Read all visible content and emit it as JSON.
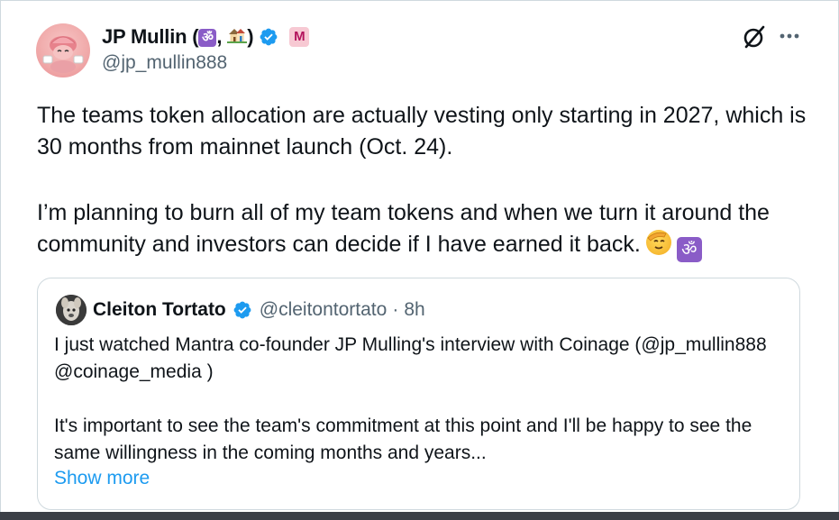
{
  "author": {
    "display_name": "JP Mullin (",
    "name_separator": ", ",
    "name_close": ")",
    "om_glyph": "ॐ",
    "mantra_badge": "M",
    "handle": "@jp_mullin888"
  },
  "tweet": {
    "paragraph_1": "The teams token allocation are actually vesting only starting in 2027, which is 30 months from mainnet launch (Oct. 24).",
    "paragraph_2": "I’m planning to burn all of my team tokens and when we turn it around the community and investors can decide if I have earned it back.",
    "trailing_om": "ॐ"
  },
  "quote": {
    "name": "Cleiton Tortato",
    "handle": "@cleitontortato",
    "separator": "·",
    "time": "8h",
    "paragraph_1": "I just watched Mantra co-founder JP Mulling's interview with Coinage (@jp_mullin888 @coinage_media )",
    "paragraph_2": "It's important to see the team's commitment at this point and I'll be happy to see the same willingness in the coming months and years...",
    "show_more": "Show more"
  },
  "icons": {
    "grok": "grok-icon",
    "more": "more-dots-icon",
    "verified": "verified-badge-icon",
    "house": "house-emoji-icon",
    "saluting": "saluting-face-emoji-icon"
  },
  "colors": {
    "text": "#0f1419",
    "secondary": "#536471",
    "link": "#1d9bf0",
    "verified": "#1d9bf0",
    "om_badge": "#8a5cc7",
    "border": "#cfd9de"
  }
}
